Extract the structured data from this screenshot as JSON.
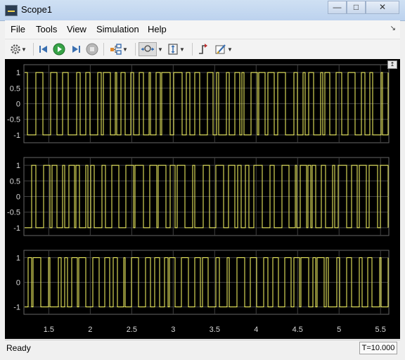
{
  "window": {
    "title": "Scope1",
    "minimize": "—",
    "maximize": "□",
    "close": "✕"
  },
  "menu": [
    "File",
    "Tools",
    "View",
    "Simulation",
    "Help"
  ],
  "toolbar_icons": [
    "gear-icon",
    "step-back-icon",
    "run-icon",
    "step-forward-icon",
    "stop-icon",
    "signal-selector-icon",
    "zoom-icon",
    "scale-axes-icon",
    "triggers-icon",
    "style-icon"
  ],
  "plots": [
    {
      "y_ticks": [
        1,
        0.5,
        0,
        -0.5,
        -1
      ],
      "y_tick_labels": [
        "1",
        "0.5",
        "0",
        "-0.5",
        "-1"
      ],
      "ylim": [
        -1.25,
        1.25
      ]
    },
    {
      "y_ticks": [
        1,
        0.5,
        0,
        -0.5,
        -1
      ],
      "y_tick_labels": [
        "1",
        "0.5",
        "0",
        "-0.5",
        "-1"
      ],
      "ylim": [
        -1.25,
        1.25
      ]
    },
    {
      "y_ticks": [
        1,
        0,
        -1
      ],
      "y_tick_labels": [
        "1",
        "0",
        "-1"
      ],
      "ylim": [
        -1.3,
        1.3
      ]
    }
  ],
  "x_axis": {
    "xlim": [
      1.2,
      5.6
    ],
    "ticks": [
      1.5,
      2,
      2.5,
      3,
      3.5,
      4,
      4.5,
      5,
      5.5
    ],
    "tick_labels": [
      "1.5",
      "2",
      "2.5",
      "3",
      "3.5",
      "4",
      "4.5",
      "5",
      "5.5"
    ]
  },
  "colors": {
    "trace": "#ffff66",
    "axes_bg": "#000000",
    "grid": "#404040",
    "axes_border": "#666666",
    "tick_text": "#d9d9d9"
  },
  "status": {
    "text": "Ready",
    "time": "T=10.000"
  }
}
